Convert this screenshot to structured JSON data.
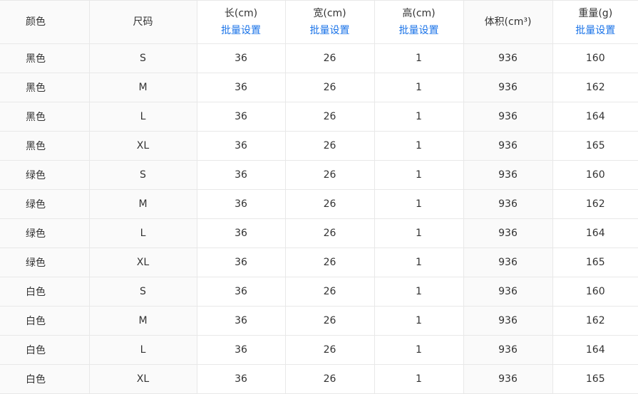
{
  "columns": [
    {
      "title": "颜色",
      "batch": null
    },
    {
      "title": "尺码",
      "batch": null
    },
    {
      "title": "长(cm)",
      "batch": "批量设置"
    },
    {
      "title": "宽(cm)",
      "batch": "批量设置"
    },
    {
      "title": "高(cm)",
      "batch": "批量设置"
    },
    {
      "title": "体积(cm³)",
      "batch": null
    },
    {
      "title": "重量(g)",
      "batch": "批量设置"
    }
  ],
  "rows": [
    [
      "黑色",
      "S",
      "36",
      "26",
      "1",
      "936",
      "160"
    ],
    [
      "黑色",
      "M",
      "36",
      "26",
      "1",
      "936",
      "162"
    ],
    [
      "黑色",
      "L",
      "36",
      "26",
      "1",
      "936",
      "164"
    ],
    [
      "黑色",
      "XL",
      "36",
      "26",
      "1",
      "936",
      "165"
    ],
    [
      "绿色",
      "S",
      "36",
      "26",
      "1",
      "936",
      "160"
    ],
    [
      "绿色",
      "M",
      "36",
      "26",
      "1",
      "936",
      "162"
    ],
    [
      "绿色",
      "L",
      "36",
      "26",
      "1",
      "936",
      "164"
    ],
    [
      "绿色",
      "XL",
      "36",
      "26",
      "1",
      "936",
      "165"
    ],
    [
      "白色",
      "S",
      "36",
      "26",
      "1",
      "936",
      "160"
    ],
    [
      "白色",
      "M",
      "36",
      "26",
      "1",
      "936",
      "162"
    ],
    [
      "白色",
      "L",
      "36",
      "26",
      "1",
      "936",
      "164"
    ],
    [
      "白色",
      "XL",
      "36",
      "26",
      "1",
      "936",
      "165"
    ]
  ],
  "colors": {
    "link": "#1a73e8",
    "border": "#e8e8e8",
    "shaded_cell": "#fafafa",
    "text": "#333333"
  }
}
